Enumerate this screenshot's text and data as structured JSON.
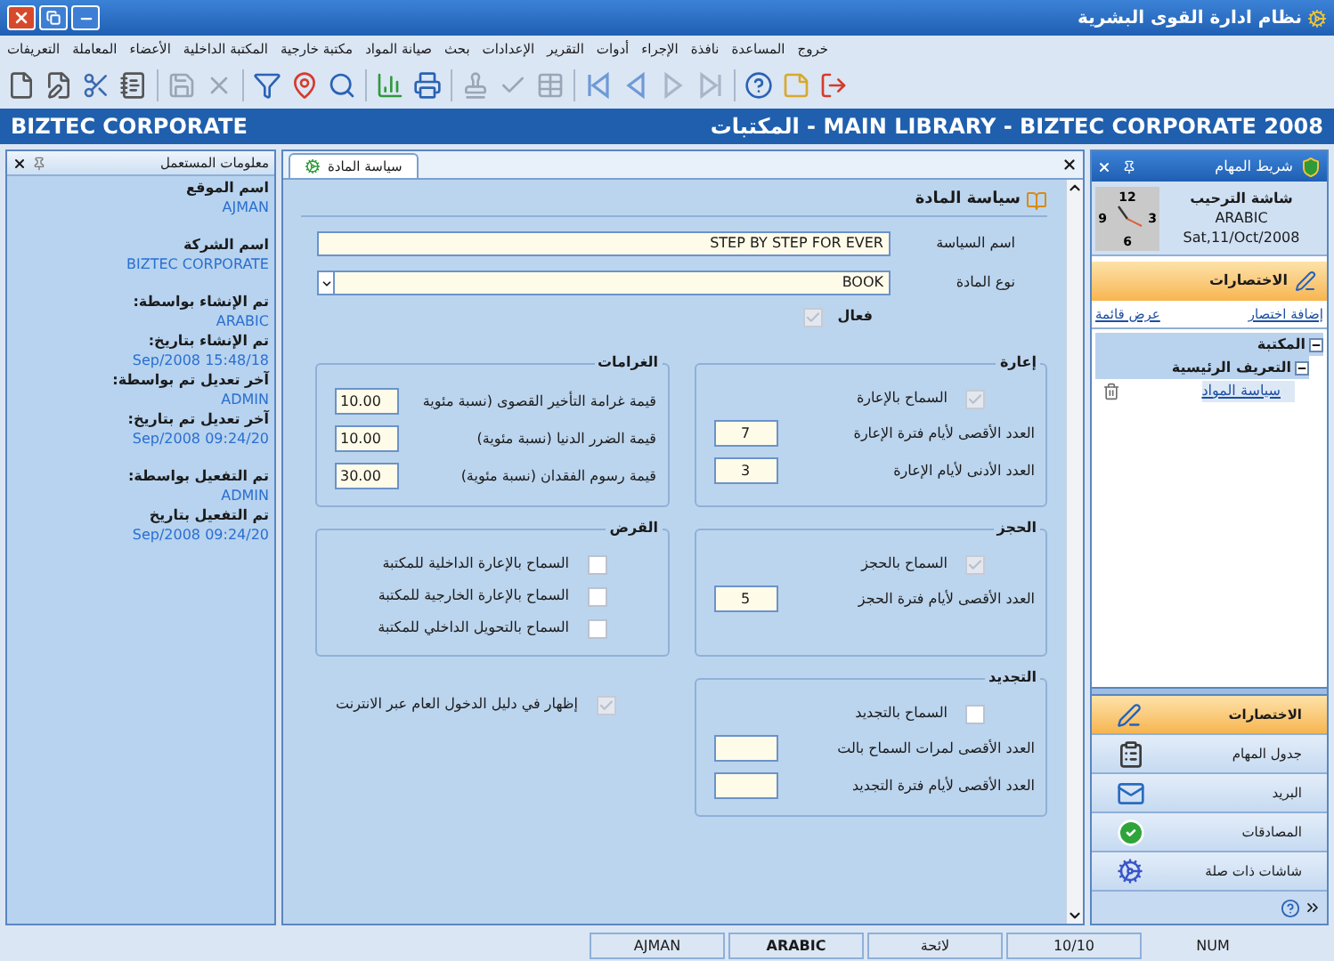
{
  "window": {
    "title": "نظام ادارة القوى البشرية"
  },
  "menu": [
    "خروج",
    "المساعدة",
    "نافذة",
    "الإجراء",
    "أدوات",
    "التقرير",
    "الإعدادات",
    "بحث",
    "صيانة المواد",
    "مكتبة خارجية",
    "المكتبة الداخلية",
    "الأعضاء",
    "المعاملة",
    "التعريفات"
  ],
  "header": {
    "company": "BIZTEC CORPORATE",
    "module": "MAIN LIBRARY - BIZTEC CORPORATE 2008 - المكتبات"
  },
  "user_info": {
    "title": "معلومات المستعمل",
    "groups": [
      [
        {
          "label": "اسم الموقع",
          "value": "AJMAN"
        }
      ],
      [
        {
          "label": "اسم الشركة",
          "value": "BIZTEC CORPORATE"
        }
      ],
      [
        {
          "label": "تم الإنشاء بواسطة:",
          "value": "ARABIC"
        },
        {
          "label": "تم الإنشاء بتاريخ:",
          "value": "Sep/2008 15:48/18"
        },
        {
          "label": "آخر تعديل تم بواسطة:",
          "value": "ADMIN"
        },
        {
          "label": "آخر تعديل تم بتاريخ:",
          "value": "Sep/2008 09:24/20"
        }
      ],
      [
        {
          "label": "تم التفعيل بواسطة:",
          "value": "ADMIN"
        },
        {
          "label": "تم التفعيل بتاريخ",
          "value": "Sep/2008 09:24/20"
        }
      ]
    ]
  },
  "form": {
    "tab": {
      "label": "سياسة المادة",
      "selected": true
    },
    "title": "سياسة المادة",
    "fields": [
      {
        "label": "اسم السياسة",
        "value": "STEP BY STEP FOR EVER",
        "kind": "text"
      },
      {
        "label": "نوع المادة",
        "value": "BOOK",
        "kind": "select"
      }
    ],
    "active": {
      "label": "فعال",
      "checked": true
    },
    "groups": [
      {
        "kind": "box",
        "title": "إعارة",
        "items": [
          {
            "kind": "checkbox",
            "label": "السماح بالإعارة",
            "checked": true
          },
          {
            "kind": "number",
            "label": "العدد الأقصى لأيام فترة الإعارة",
            "value": "7"
          },
          {
            "kind": "number",
            "label": "العدد الأدنى لأيام الإعارة",
            "value": "3"
          }
        ]
      },
      {
        "kind": "box",
        "title": "الغرامات",
        "items": [
          {
            "kind": "amount",
            "label": "قيمة غرامة التأخير القصوى (نسبة مئوية",
            "value": "10.00"
          },
          {
            "kind": "amount",
            "label": "قيمة الضرر الدنيا (نسبة مئوية)",
            "value": "10.00"
          },
          {
            "kind": "amount",
            "label": "قيمة رسوم الفقدان (نسبة مئوية)",
            "value": "30.00"
          }
        ]
      },
      {
        "kind": "box",
        "title": "الحجز",
        "items": [
          {
            "kind": "checkbox",
            "label": "السماح بالحجز",
            "checked": true
          },
          {
            "kind": "number",
            "label": "العدد الأقصى لأيام فترة الحجز",
            "value": "5"
          }
        ]
      },
      {
        "kind": "box",
        "title": "القرض",
        "items": [
          {
            "kind": "checkbox",
            "label": "السماح بالإعارة الداخلية للمكتبة",
            "checked": false
          },
          {
            "kind": "checkbox",
            "label": "السماح بالإعارة الخارجية للمكتبة",
            "checked": false
          },
          {
            "kind": "checkbox",
            "label": "السماح بالتحويل الداخلي للمكتبة",
            "checked": false
          }
        ]
      },
      {
        "kind": "box",
        "title": "التجديد",
        "items": [
          {
            "kind": "checkbox",
            "label": "السماح بالتجديد",
            "checked": false
          },
          {
            "kind": "number",
            "label": "العدد الأقصى لمرات السماح بالت"
          },
          {
            "kind": "number",
            "label": "العدد الأقصى لأيام فترة التجديد"
          }
        ]
      },
      {
        "kind": "plain",
        "items": [
          {
            "kind": "checkbox",
            "label": "إظهار في دليل الدخول العام عبر الانترنت",
            "checked": true
          }
        ]
      }
    ]
  },
  "taskbar": {
    "title": "شريط المهام",
    "clock": [
      "12",
      "3",
      "6",
      "9"
    ],
    "welcome": {
      "title": "شاشة الترحيب",
      "language": "ARABIC",
      "date": "Sat,11/Oct/2008"
    },
    "shortcuts_title": "الاختصارات",
    "links": [
      "إضافة اختصار",
      "عرض قائمة"
    ],
    "tree": [
      {
        "label": "المكتبة",
        "expanded": true,
        "children": [
          {
            "label": "التعريف الرئيسية",
            "expanded": true,
            "children": [
              {
                "label": "سياسة المواد"
              }
            ]
          }
        ]
      }
    ],
    "nav": [
      {
        "label": "الاختصارات",
        "kind": "shortcuts",
        "selected": true
      },
      {
        "label": "جدول المهام",
        "kind": "tasks",
        "selected": false
      },
      {
        "label": "البريد",
        "kind": "mail",
        "selected": false
      },
      {
        "label": "المصادقات",
        "kind": "approvals",
        "selected": false
      },
      {
        "label": "شاشات ذات صلة",
        "kind": "related",
        "selected": false
      }
    ]
  },
  "status_bar": [
    {
      "text": "NUM",
      "bold": false
    },
    {
      "text": "10/10",
      "bold": false
    },
    {
      "text": "لائحة",
      "bold": false
    },
    {
      "text": "ARABIC",
      "bold": true
    },
    {
      "text": "AJMAN",
      "bold": false
    }
  ]
}
